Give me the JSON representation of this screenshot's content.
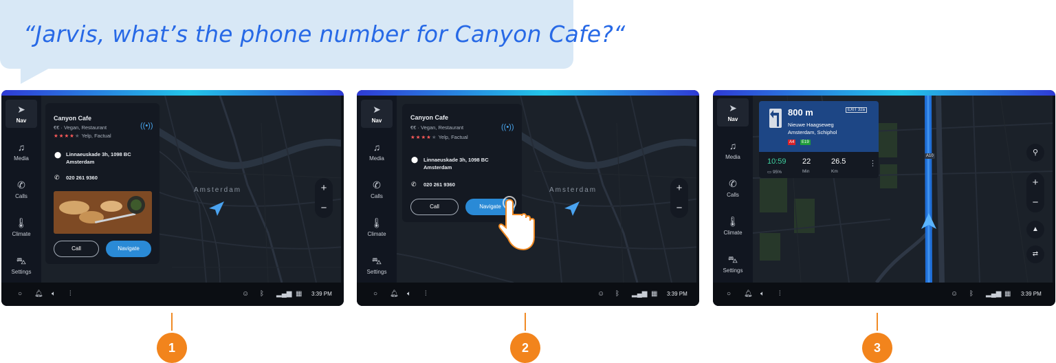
{
  "bubble": {
    "text": "“Jarvis, what’s the phone number for Canyon Cafe?“"
  },
  "sidebar": {
    "items": [
      {
        "label": "Nav",
        "icon": "navigation-arrow-icon"
      },
      {
        "label": "Media",
        "icon": "music-note-icon"
      },
      {
        "label": "Calls",
        "icon": "phone-icon"
      },
      {
        "label": "Climate",
        "icon": "thermometer-icon"
      },
      {
        "label": "Settings",
        "icon": "car-icon"
      }
    ]
  },
  "statusbar": {
    "time": "3:39 PM"
  },
  "map": {
    "city_label": "Amsterdam"
  },
  "place": {
    "name": "Canyon Cafe",
    "category": "€€ · Vegan, Restaurant",
    "rating_source": "Yelp, Factual",
    "stars": 4,
    "address_line1": "Linnaeuskade 3h, 1098 BC",
    "address_line2": "Amsterdam",
    "phone": "020 261 9360",
    "call_label": "Call",
    "navigate_label": "Navigate"
  },
  "guidance": {
    "distance": "800 m",
    "exit_label": "EXIT",
    "exit_number": "32a",
    "street": "Nieuwe Haagseweg",
    "destination": "Amsterdam, Schiphol",
    "road_badges": [
      "A4",
      "E19"
    ],
    "road_badge_colors": [
      "#d9232a",
      "#1f9d3a"
    ],
    "arrival": "10:59",
    "battery": "95%",
    "duration_value": "22",
    "duration_unit": "Min",
    "distance_value": "26.5",
    "distance_unit": "Km",
    "road_label": "A10"
  },
  "markers": [
    "1",
    "2",
    "3"
  ],
  "colors": {
    "accent": "#2a8ad6",
    "marker": "#f2841c",
    "bubble": "#d8e8f6",
    "bubble_text": "#2769e6"
  }
}
